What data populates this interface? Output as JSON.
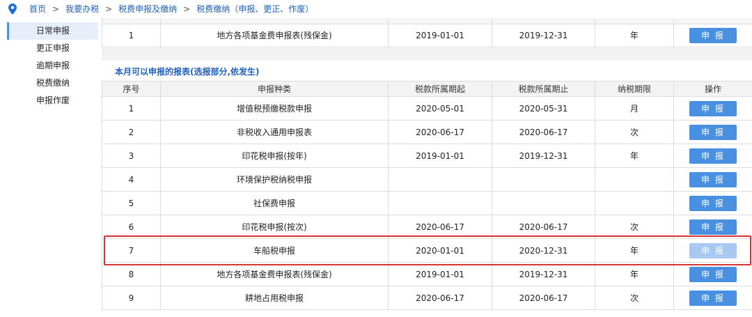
{
  "breadcrumb": {
    "pin_icon": "location-pin-icon",
    "items": [
      "首页",
      "我要办税",
      "税费申报及缴纳",
      "税费缴纳（申报、更正、作废）"
    ],
    "separator": ">"
  },
  "colors": {
    "accent": "#4a90e2",
    "link": "#1f5fbf",
    "highlight_border": "#d63333",
    "disabled_button": "#a7c8f1"
  },
  "sidebar": {
    "items": [
      {
        "label": "日常申报",
        "active": true
      },
      {
        "label": "更正申报",
        "active": false
      },
      {
        "label": "逾期申报",
        "active": false
      },
      {
        "label": "税费缴纳",
        "active": false
      },
      {
        "label": "申报作废",
        "active": false
      }
    ]
  },
  "top_table": {
    "row": {
      "no": "1",
      "type": "地方各项基金费申报表(残保金)",
      "start": "2019-01-01",
      "end": "2019-12-31",
      "period": "年",
      "action": "申 报"
    }
  },
  "section": {
    "title": "本月可以申报的报表(选报部分,依发生)",
    "columns": [
      "序号",
      "申报种类",
      "税款所属期起",
      "税款所属期止",
      "纳税期限",
      "操作"
    ],
    "rows": [
      {
        "no": "1",
        "type": "增值税预缴税款申报",
        "start": "2020-05-01",
        "end": "2020-05-31",
        "period": "月",
        "action": "申 报"
      },
      {
        "no": "2",
        "type": "非税收入通用申报表",
        "start": "2020-06-17",
        "end": "2020-06-17",
        "period": "次",
        "action": "申 报"
      },
      {
        "no": "3",
        "type": "印花税申报(按年)",
        "start": "2019-01-01",
        "end": "2019-12-31",
        "period": "年",
        "action": "申 报"
      },
      {
        "no": "4",
        "type": "环境保护税纳税申报",
        "start": "",
        "end": "",
        "period": "",
        "action": "申 报"
      },
      {
        "no": "5",
        "type": "社保费申报",
        "start": "",
        "end": "",
        "period": "",
        "action": "申 报"
      },
      {
        "no": "6",
        "type": "印花税申报(按次)",
        "start": "2020-06-17",
        "end": "2020-06-17",
        "period": "次",
        "action": "申 报"
      },
      {
        "no": "7",
        "type": "车船税申报",
        "start": "2020-01-01",
        "end": "2020-12-31",
        "period": "年",
        "action": "申 报",
        "highlighted": true
      },
      {
        "no": "8",
        "type": "地方各项基金费申报表(残保金)",
        "start": "2019-01-01",
        "end": "2019-12-31",
        "period": "年",
        "action": "申 报"
      },
      {
        "no": "9",
        "type": "耕地占用税申报",
        "start": "2020-06-17",
        "end": "2020-06-17",
        "period": "次",
        "action": "申 报"
      }
    ]
  }
}
